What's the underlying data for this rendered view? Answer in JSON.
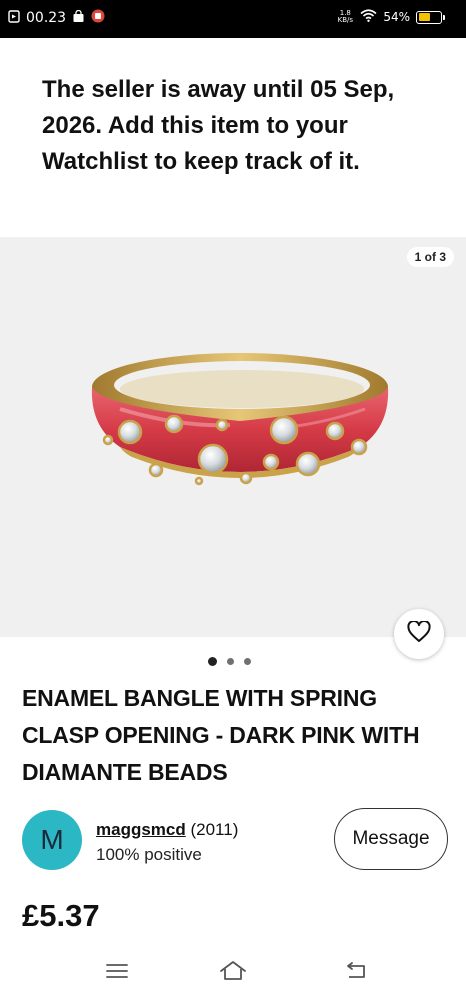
{
  "status_bar": {
    "time": "00.23",
    "speed_value": "1.8",
    "speed_unit": "KB/s",
    "battery": "54%",
    "battery_level": 0.54
  },
  "away_banner": {
    "text": "The seller is away until 05 Sep, 2026. Add this item to your Watchlist to keep track of it."
  },
  "image_viewer": {
    "counter": "1 of 3",
    "image_count": 3,
    "active_index": 0
  },
  "listing": {
    "title": "ENAMEL BANGLE WITH SPRING CLASP OPENING - DARK PINK WITH DIAMANTE BEADS",
    "price": "£5.37"
  },
  "seller": {
    "initial": "M",
    "name": "maggsmcd",
    "feedback_count": "(2011)",
    "feedback": "100% positive",
    "message_label": "Message"
  },
  "colors": {
    "avatar": "#2bb7c4",
    "enamel": "#d9434e",
    "gold": "#c9a24a"
  }
}
